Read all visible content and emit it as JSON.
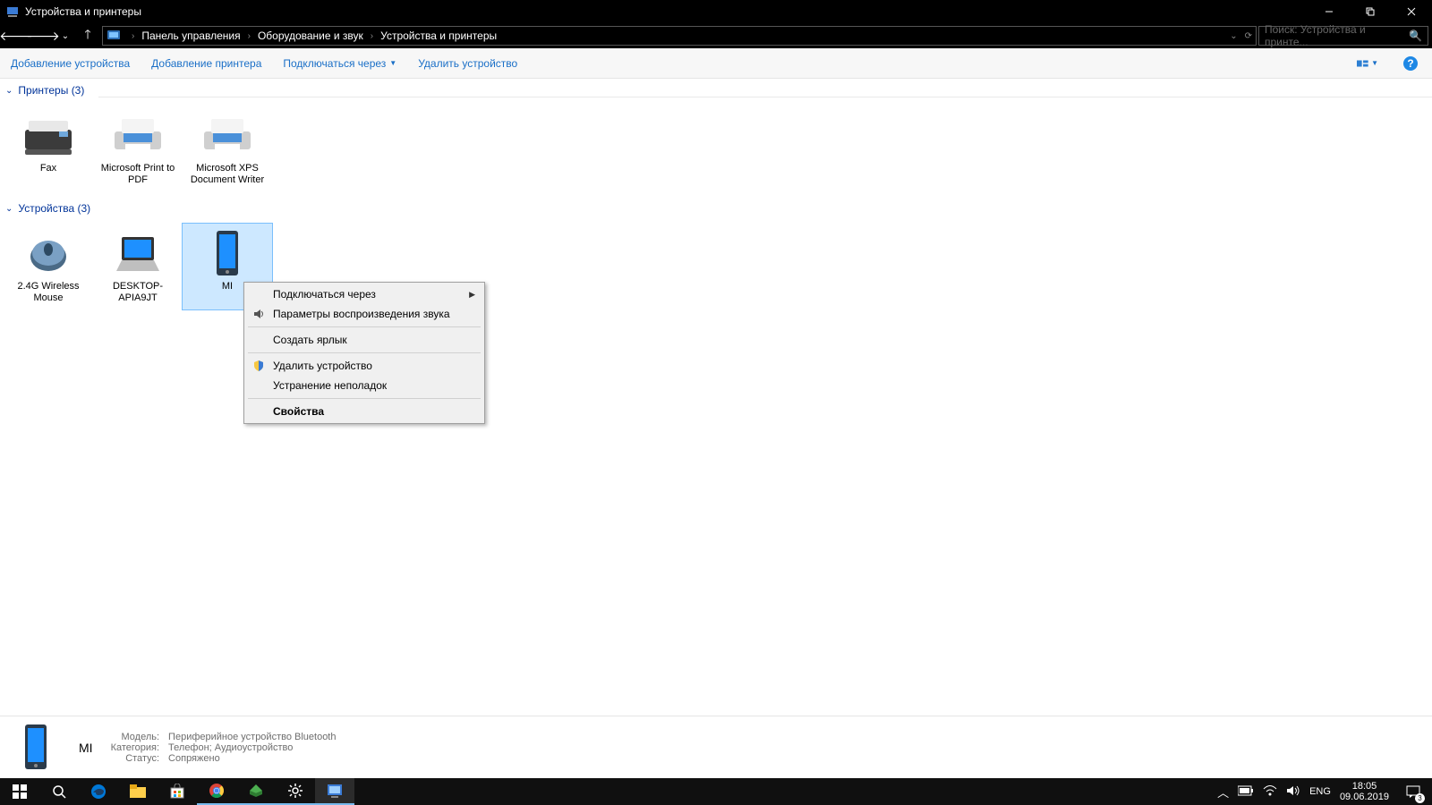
{
  "titlebar": {
    "title": "Устройства и принтеры"
  },
  "breadcrumb": {
    "items": [
      "Панель управления",
      "Оборудование и звук",
      "Устройства и принтеры"
    ]
  },
  "search": {
    "placeholder": "Поиск: Устройства и принте..."
  },
  "toolbar": {
    "add_device": "Добавление устройства",
    "add_printer": "Добавление принтера",
    "connect_via": "Подключаться через",
    "remove_device": "Удалить устройство"
  },
  "groups": {
    "printers": {
      "title": "Принтеры (3)",
      "items": [
        {
          "label": "Fax"
        },
        {
          "label": "Microsoft Print to PDF"
        },
        {
          "label": "Microsoft XPS Document Writer"
        }
      ]
    },
    "devices": {
      "title": "Устройства (3)",
      "items": [
        {
          "label": "2.4G Wireless Mouse"
        },
        {
          "label": "DESKTOP-APIA9JT"
        },
        {
          "label": "MI"
        }
      ]
    }
  },
  "context_menu": {
    "connect_via": "Подключаться через",
    "sound_playback": "Параметры воспроизведения звука",
    "create_shortcut": "Создать ярлык",
    "remove_device": "Удалить устройство",
    "troubleshoot": "Устранение неполадок",
    "properties": "Свойства"
  },
  "details": {
    "name": "MI",
    "model_k": "Модель:",
    "model_v": "Периферийное устройство Bluetooth",
    "category_k": "Категория:",
    "category_v": "Телефон; Аудиоустройство",
    "status_k": "Статус:",
    "status_v": "Сопряжено"
  },
  "tray": {
    "lang": "ENG",
    "time": "18:05",
    "date": "09.06.2019",
    "notif_count": "3"
  }
}
